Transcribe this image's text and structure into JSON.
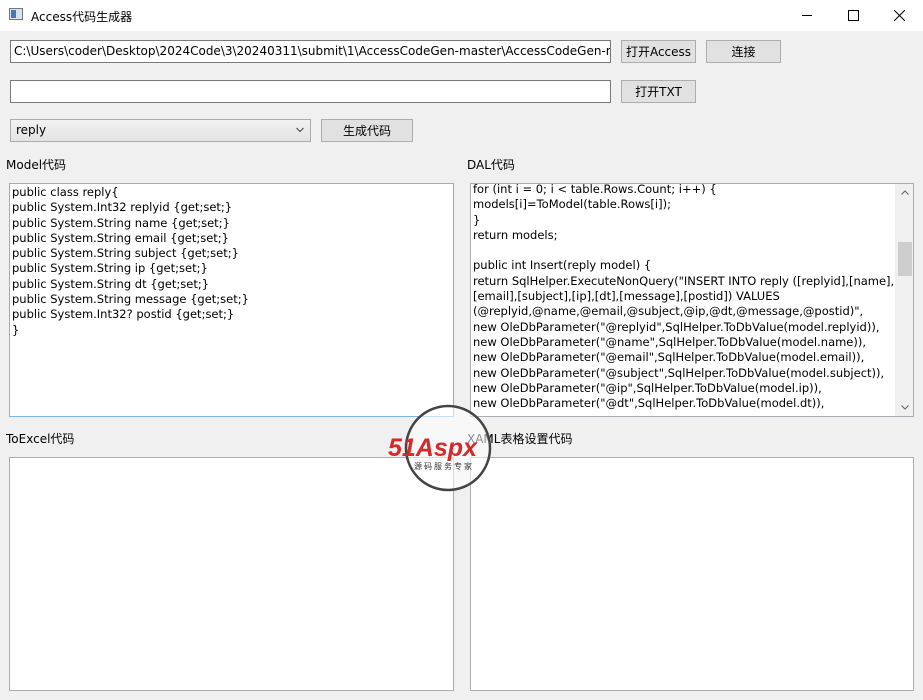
{
  "window": {
    "title": "Access代码生成器",
    "minimize_label": "—",
    "maximize_label": "☐",
    "close_label": "✕"
  },
  "toolbar": {
    "path_value": "C:\\Users\\coder\\Desktop\\2024Code\\3\\20240311\\submit\\1\\AccessCodeGen-master\\AccessCodeGen-mas",
    "open_access_label": "打开Access",
    "connect_label": "连接",
    "txt_value": "",
    "open_txt_label": "打开TXT",
    "table_selected": "reply",
    "generate_label": "生成代码"
  },
  "panels": {
    "model_label": "Model代码",
    "dal_label": "DAL代码",
    "toexcel_label": "ToExcel代码",
    "xaml_label": "XAML表格设置代码"
  },
  "model_code": [
    "public class reply{",
    "public System.Int32 replyid {get;set;}",
    "public System.String name {get;set;}",
    "public System.String email {get;set;}",
    "public System.String subject {get;set;}",
    "public System.String ip {get;set;}",
    "public System.String dt {get;set;}",
    "public System.String message {get;set;}",
    "public System.Int32? postid {get;set;}",
    "}"
  ],
  "dal_code": [
    "for (int i = 0; i < table.Rows.Count; i++) {",
    "models[i]=ToModel(table.Rows[i]);",
    "}",
    "return models;",
    "",
    "public int Insert(reply model) {",
    "return SqlHelper.ExecuteNonQuery(\"INSERT INTO reply ([replyid],[name],",
    "[email],[subject],[ip],[dt],[message],[postid]) VALUES",
    "(@replyid,@name,@email,@subject,@ip,@dt,@message,@postid)\",",
    "new OleDbParameter(\"@replyid\",SqlHelper.ToDbValue(model.replyid)),",
    "new OleDbParameter(\"@name\",SqlHelper.ToDbValue(model.name)),",
    "new OleDbParameter(\"@email\",SqlHelper.ToDbValue(model.email)),",
    "new OleDbParameter(\"@subject\",SqlHelper.ToDbValue(model.subject)),",
    "new OleDbParameter(\"@ip\",SqlHelper.ToDbValue(model.ip)),",
    "new OleDbParameter(\"@dt\",SqlHelper.ToDbValue(model.dt)),"
  ],
  "watermark": {
    "brand": "51Aspx",
    "tagline": "源码服务专家"
  },
  "colors": {
    "watermark_red": "#d42a2a",
    "watermark_green": "#3aa63a",
    "focus_border": "#7eb4ea"
  }
}
